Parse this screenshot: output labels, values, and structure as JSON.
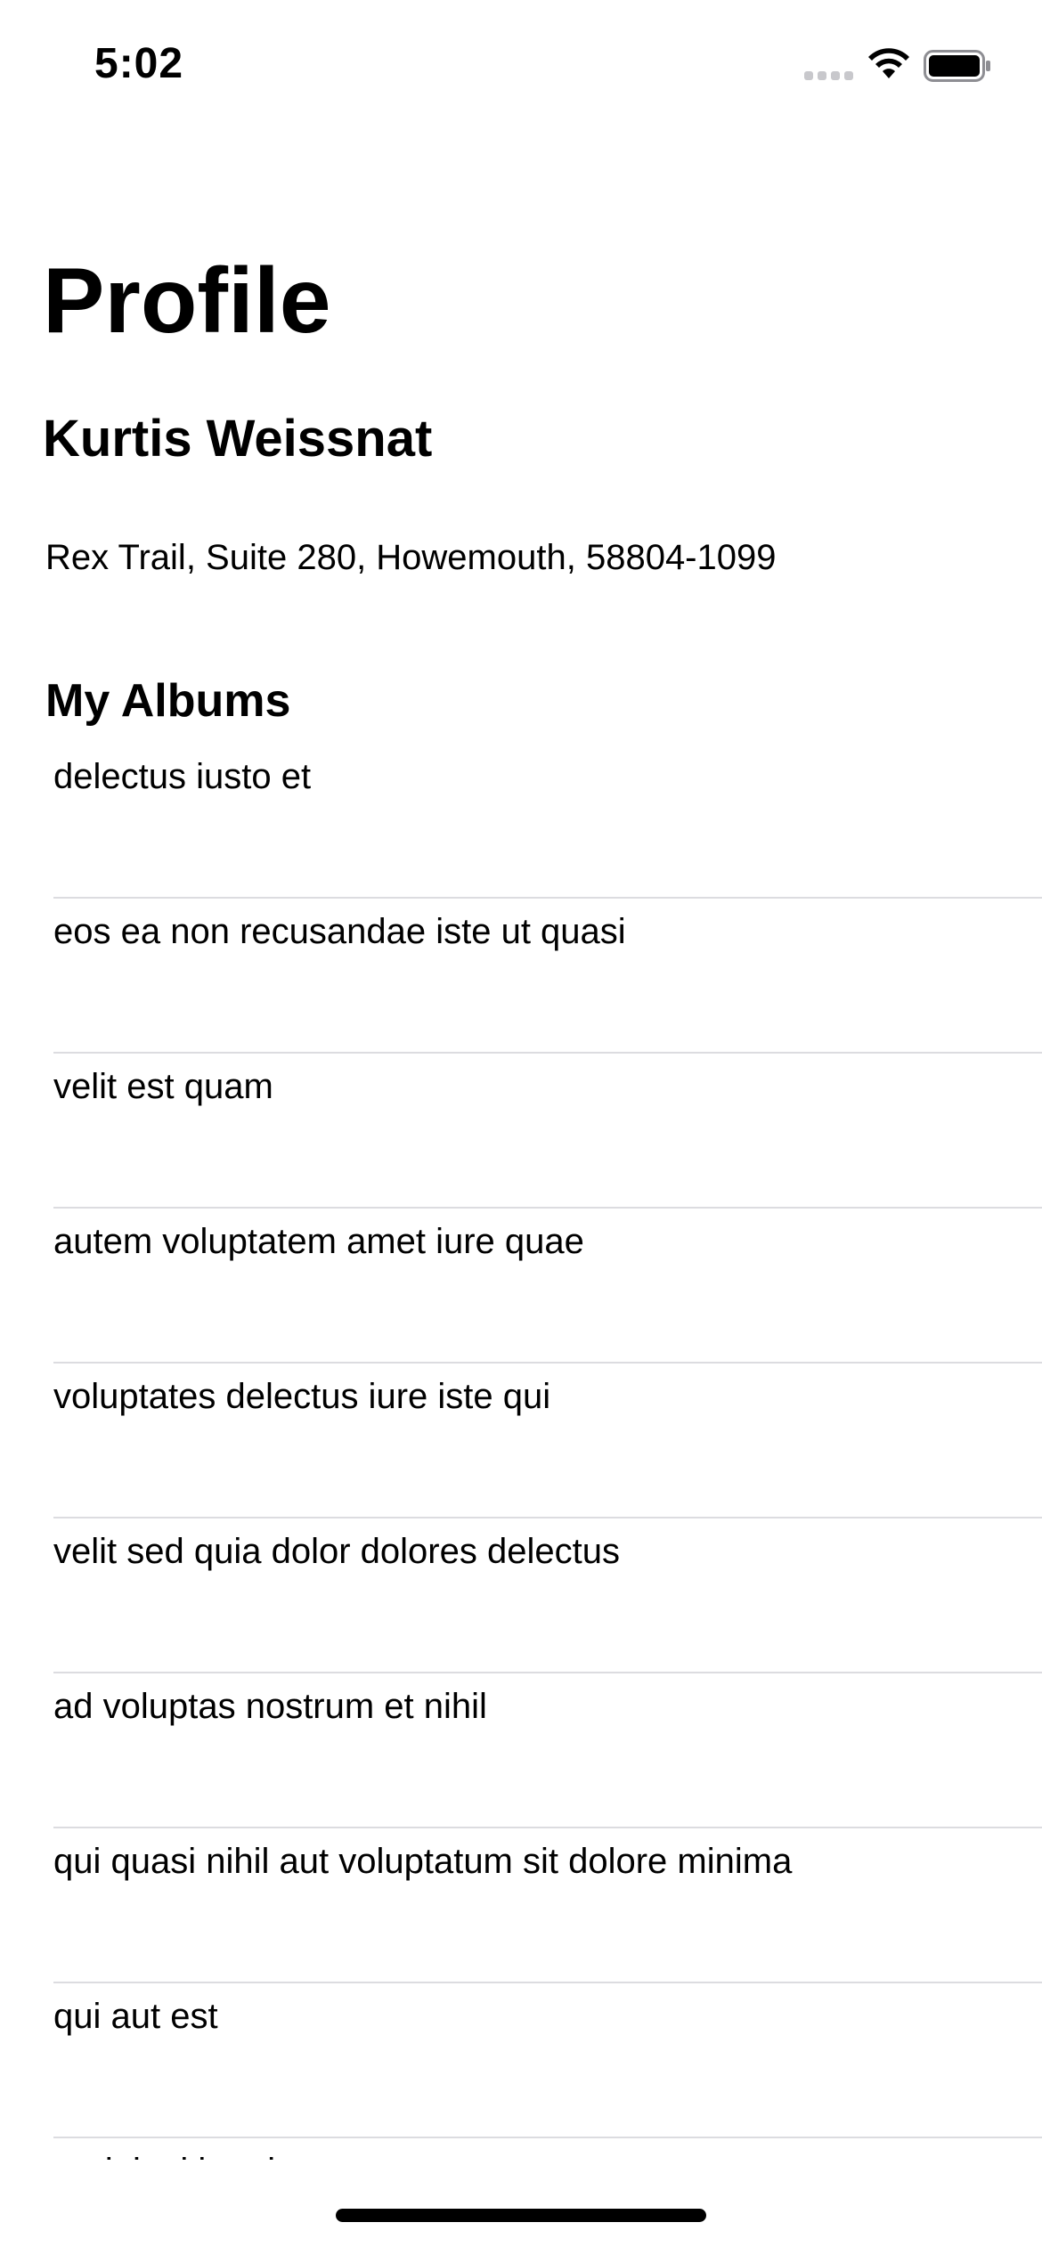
{
  "status_bar": {
    "time": "5:02",
    "icons": [
      "signal-icon",
      "wifi-icon",
      "battery-icon"
    ]
  },
  "header": {
    "title": "Profile"
  },
  "profile": {
    "name": "Kurtis Weissnat",
    "address": "Rex Trail, Suite 280, Howemouth, 58804-1099"
  },
  "albums": {
    "title": "My Albums",
    "items": [
      "delectus iusto et",
      "eos ea non recusandae iste ut quasi",
      "velit est quam",
      "autem voluptatem amet iure quae",
      "voluptates delectus iure iste qui",
      "velit sed quia dolor dolores delectus",
      "ad voluptas nostrum et nihil",
      "qui quasi nihil aut voluptatum sit dolore minima",
      "qui aut est",
      "et deleniti unde"
    ]
  },
  "colors": {
    "background": "#ffffff",
    "text": "#000000",
    "separator": "#dcdce0"
  }
}
